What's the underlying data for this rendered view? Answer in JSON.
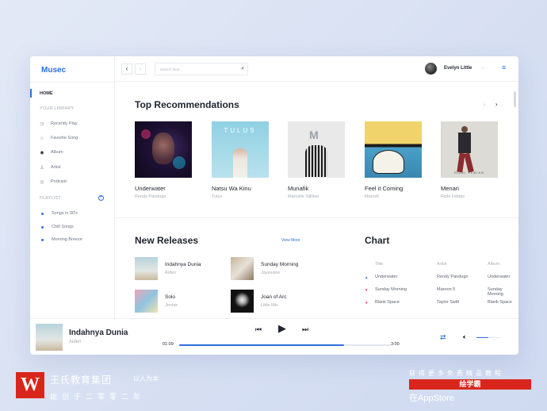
{
  "brand": "Musec",
  "sidebar": {
    "home": "HOME",
    "library_label": "YOUR LIBRARY",
    "library": [
      {
        "label": "Recently Play",
        "icon": "clock-icon"
      },
      {
        "label": "Favorite Song",
        "icon": "star-icon"
      },
      {
        "label": "Album",
        "icon": "disc-icon"
      },
      {
        "label": "Artist",
        "icon": "user-icon"
      },
      {
        "label": "Podcast",
        "icon": "podcast-icon"
      }
    ],
    "playlist_label": "PLAYLIST",
    "playlists": [
      "Songs in 90's",
      "Chill Songs",
      "Morning Breeze"
    ]
  },
  "topbar": {
    "search_placeholder": "Search here...",
    "user_name": "Evelyn Little"
  },
  "recommendations": {
    "title": "Top Recommendations",
    "items": [
      {
        "title": "Underwater",
        "artist": "Rendy Pandugo"
      },
      {
        "title": "Natsu Wa Kinu",
        "artist": "Tulus"
      },
      {
        "title": "Munafik",
        "artist": "Marcelle Tallitoe"
      },
      {
        "title": "Feel it Coming",
        "artist": "Marcell"
      },
      {
        "title": "Menari",
        "artist": "Rizki Febian"
      }
    ]
  },
  "releases": {
    "title": "New Releases",
    "view_more": "View More",
    "items": [
      {
        "title": "Indahnya Dunia",
        "artist": "Aiden"
      },
      {
        "title": "Sunday Morning",
        "artist": "Jayesslee"
      },
      {
        "title": "Solo",
        "artist": "Jennie"
      },
      {
        "title": "Joan of Arc",
        "artist": "Little Mix"
      }
    ]
  },
  "chart": {
    "title": "Chart",
    "headers": [
      "Title",
      "Artist",
      "Album"
    ],
    "rows": [
      {
        "title": "Underwater",
        "artist": "Rendy Pandugo",
        "album": "Underwater",
        "trend": "up"
      },
      {
        "title": "Sunday Morning",
        "artist": "Maroon 5",
        "album": "Sunday Morning",
        "trend": "down"
      },
      {
        "title": "Blank Space",
        "artist": "Taylor Swift",
        "album": "Blank Space",
        "trend": "down"
      }
    ]
  },
  "player": {
    "title": "Indahnya Dunia",
    "artist": "Aiden",
    "elapsed": "01:09",
    "duration": "3:00",
    "progress": 0.78,
    "volume": 0.5
  },
  "watermark": {
    "logo_char": "W",
    "line1": "王氏教育集团",
    "line1b": "以人为本",
    "line2": "始创于二零零二年",
    "line3": "获得更多免费精品教程",
    "line4": "绘学霸",
    "line5": "在AppStore"
  },
  "colors": {
    "accent": "#2f6fe0",
    "brand_red": "#d9261c"
  }
}
